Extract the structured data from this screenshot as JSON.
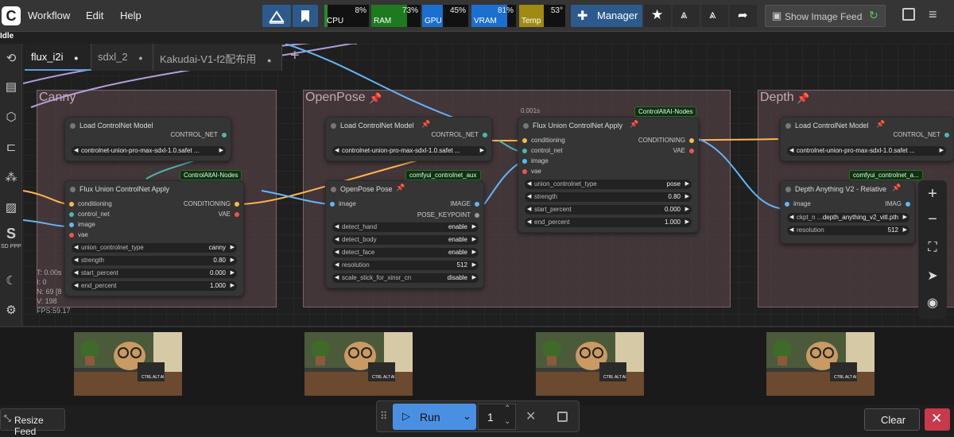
{
  "menu": {
    "logo": "C",
    "workflow": "Workflow",
    "edit": "Edit",
    "help": "Help"
  },
  "meters": [
    {
      "label": "CPU",
      "value": "8%",
      "fill": 0.08,
      "color": "#2a8a2a"
    },
    {
      "label": "RAM",
      "value": "73%",
      "fill": 0.73,
      "color": "#1e7a1e"
    },
    {
      "label": "GPU",
      "value": "45%",
      "fill": 0.45,
      "color": "#1b6fd0"
    },
    {
      "label": "VRAM",
      "value": "81%",
      "fill": 0.81,
      "color": "#1b6fd0"
    },
    {
      "label": "Temp",
      "value": "53°",
      "fill": 0.53,
      "color": "#a08a10"
    }
  ],
  "toolbar": {
    "manager": "Manager",
    "show_image_feed": "Show Image Feed"
  },
  "status": "Idle",
  "tabs": [
    {
      "label": "flux_i2i",
      "marker": "●"
    },
    {
      "label": "sdxl_2",
      "marker": "●"
    },
    {
      "label": "Kakudai-V1-f2配布用",
      "marker": "●"
    }
  ],
  "add_tab": "+",
  "groups": {
    "canny": "Canny",
    "openpose": "OpenPose",
    "depth": "Depth"
  },
  "nodes": {
    "canny_load": {
      "title": "Load ControlNet Model",
      "out": "CONTROL_NET",
      "model": "controlnet-union-pro-max-sdxl-1.0.safet ..."
    },
    "canny_apply": {
      "title": "Flux Union ControlNet Apply",
      "badge": "ControlAltAI-Nodes",
      "inputs": [
        "conditioning",
        "control_net",
        "image",
        "vae"
      ],
      "outputs": [
        "CONDITIONING",
        "VAE"
      ],
      "widgets": [
        {
          "label": "union_controlnet_type",
          "value": "canny"
        },
        {
          "label": "strength",
          "value": "0.80"
        },
        {
          "label": "start_percent",
          "value": "0.000"
        },
        {
          "label": "end_percent",
          "value": "1.000"
        }
      ]
    },
    "pose_load": {
      "title": "Load ControlNet Model",
      "out": "CONTROL_NET",
      "model": "controlnet-union-pro-max-sdxl-1.0.safet ..."
    },
    "pose_pre": {
      "title": "OpenPose Pose",
      "badge": "comfyui_controlnet_aux",
      "input": "image",
      "outputs": [
        "IMAGE",
        "POSE_KEYPOINT"
      ],
      "widgets": [
        {
          "label": "detect_hand",
          "value": "enable"
        },
        {
          "label": "detect_body",
          "value": "enable"
        },
        {
          "label": "detect_face",
          "value": "enable"
        },
        {
          "label": "resolution",
          "value": "512"
        },
        {
          "label": "scale_stick_for_xinsr_cn",
          "value": "disable"
        }
      ]
    },
    "pose_apply": {
      "title": "Flux Union ControlNet Apply",
      "badge": "ControlAltAI-Nodes",
      "time": "0.001s",
      "inputs": [
        "conditioning",
        "control_net",
        "image",
        "vae"
      ],
      "outputs": [
        "CONDITIONING",
        "VAE"
      ],
      "widgets": [
        {
          "label": "union_controlnet_type",
          "value": "pose"
        },
        {
          "label": "strength",
          "value": "0.80"
        },
        {
          "label": "start_percent",
          "value": "0.000"
        },
        {
          "label": "end_percent",
          "value": "1.000"
        }
      ]
    },
    "depth_load": {
      "title": "Load ControlNet Model",
      "out": "CONTROL_NET",
      "model": "controlnet-union-pro-max-sdxl-1.0.safet ..."
    },
    "depth_pre": {
      "title": "Depth Anything V2 - Relative",
      "badge": "comfyui_controlnet_a...",
      "input": "image",
      "output": "IMAG",
      "widgets": [
        {
          "label": "ckpt_n ...",
          "value": "depth_anything_v2_vitl.pth"
        },
        {
          "label": "resolution",
          "value": "512"
        }
      ]
    }
  },
  "stats": [
    "T: 0.00s",
    "I: 0",
    "N: 69 [8",
    "V: 198",
    "FPS:59.17"
  ],
  "bottom": {
    "resize_feed": "Resize Feed",
    "run": "Run",
    "batch": "1",
    "clear": "Clear"
  },
  "thumbnail_caption": "CTRL ALT AI"
}
